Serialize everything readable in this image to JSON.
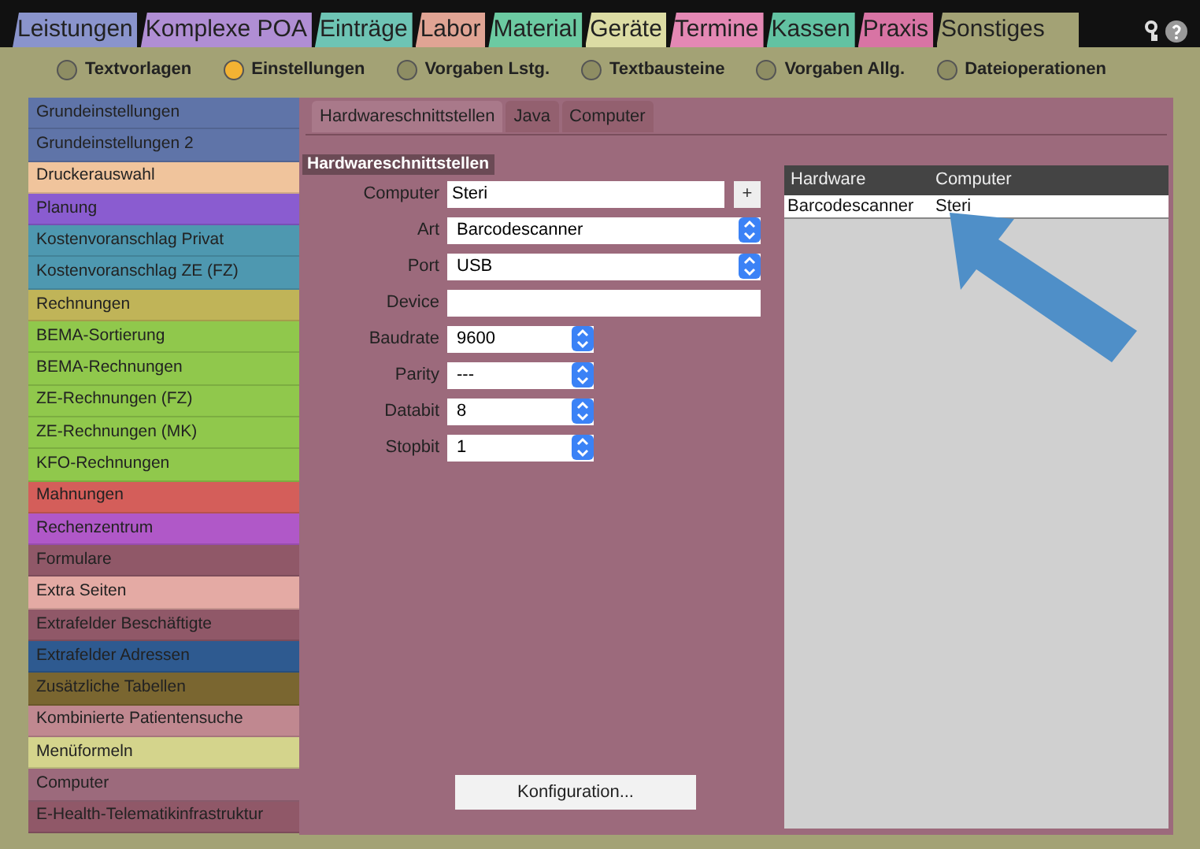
{
  "top_tabs": [
    {
      "label": "Leistungen",
      "color": "#8a94cc",
      "selected": false
    },
    {
      "label": "Komplexe POA",
      "color": "#b08ed4",
      "selected": false
    },
    {
      "label": "Einträge",
      "color": "#6ec4b4",
      "selected": false
    },
    {
      "label": "Labor",
      "color": "#e0a494",
      "selected": false
    },
    {
      "label": "Material",
      "color": "#6ccaa2",
      "selected": false
    },
    {
      "label": "Geräte",
      "color": "#dcdca4",
      "selected": false
    },
    {
      "label": "Termine",
      "color": "#e488b4",
      "selected": false
    },
    {
      "label": "Kassen",
      "color": "#62c2a2",
      "selected": false
    },
    {
      "label": "Praxis",
      "color": "#d874a4",
      "selected": false
    },
    {
      "label": "Sonstiges",
      "color": "#a3a275",
      "selected": true
    }
  ],
  "sections": [
    {
      "label": "Textvorlagen",
      "selected": false
    },
    {
      "label": "Einstellungen",
      "selected": true
    },
    {
      "label": "Vorgaben Lstg.",
      "selected": false
    },
    {
      "label": "Textbausteine",
      "selected": false
    },
    {
      "label": "Vorgaben Allg.",
      "selected": false
    },
    {
      "label": "Dateioperationen",
      "selected": false
    }
  ],
  "sidebar": {
    "items": [
      {
        "label": "Grundeinstellungen",
        "color": "#5f74a8"
      },
      {
        "label": "Grundeinstellungen 2",
        "color": "#5f74a8"
      },
      {
        "label": "Druckerauswahl",
        "color": "#f0c49c"
      },
      {
        "label": "Planung",
        "color": "#8a5cd0"
      },
      {
        "label": "Kostenvoranschlag Privat",
        "color": "#4e98b0"
      },
      {
        "label": "Kostenvoranschlag ZE (FZ)",
        "color": "#4e98b0"
      },
      {
        "label": "Rechnungen",
        "color": "#c0b458"
      },
      {
        "label": "BEMA-Sortierung",
        "color": "#90c84c"
      },
      {
        "label": "BEMA-Rechnungen",
        "color": "#90c84c"
      },
      {
        "label": "ZE-Rechnungen (FZ)",
        "color": "#90c84c"
      },
      {
        "label": "ZE-Rechnungen (MK)",
        "color": "#90c84c"
      },
      {
        "label": "KFO-Rechnungen",
        "color": "#90c84c"
      },
      {
        "label": "Mahnungen",
        "color": "#d45e5a"
      },
      {
        "label": "Rechenzentrum",
        "color": "#b058c8"
      },
      {
        "label": "Formulare",
        "color": "#905868"
      },
      {
        "label": "Extra Seiten",
        "color": "#e4aaa4"
      },
      {
        "label": "Extrafelder Beschäftigte",
        "color": "#905868"
      },
      {
        "label": "Extrafelder Adressen",
        "color": "#2e5a90"
      },
      {
        "label": "Zusätzliche Tabellen",
        "color": "#7a6630"
      },
      {
        "label": "Kombinierte Patientensuche",
        "color": "#c08890"
      },
      {
        "label": "Menüformeln",
        "color": "#d4d48c"
      },
      {
        "label": "Computer",
        "color": "#9c6a7c"
      },
      {
        "label": "E-Health-Telematikinfrastruktur",
        "color": "#905868"
      }
    ]
  },
  "sub_tabs": [
    {
      "label": "Hardwareschnittstellen",
      "selected": true
    },
    {
      "label": "Java",
      "selected": false
    },
    {
      "label": "Computer",
      "selected": false
    }
  ],
  "group_title": "Hardwareschnittstellen",
  "fields": [
    {
      "label": "Computer",
      "kind": "text_add",
      "value": "Steri",
      "add": "+"
    },
    {
      "label": "Art",
      "kind": "select_wide",
      "value": "Barcodescanner"
    },
    {
      "label": "Port",
      "kind": "select_wide",
      "value": "USB"
    },
    {
      "label": "Device",
      "kind": "text"
    },
    {
      "label": "Baudrate",
      "kind": "select",
      "value": "9600"
    },
    {
      "label": "Parity",
      "kind": "select",
      "value": "---"
    },
    {
      "label": "Databit",
      "kind": "select",
      "value": "8"
    },
    {
      "label": "Stopbit",
      "kind": "select",
      "value": "1"
    }
  ],
  "config_button": "Konfiguration...",
  "table": {
    "columns": [
      "Hardware",
      "Computer"
    ],
    "rows": [
      [
        "Barcodescanner",
        "Steri"
      ]
    ]
  }
}
